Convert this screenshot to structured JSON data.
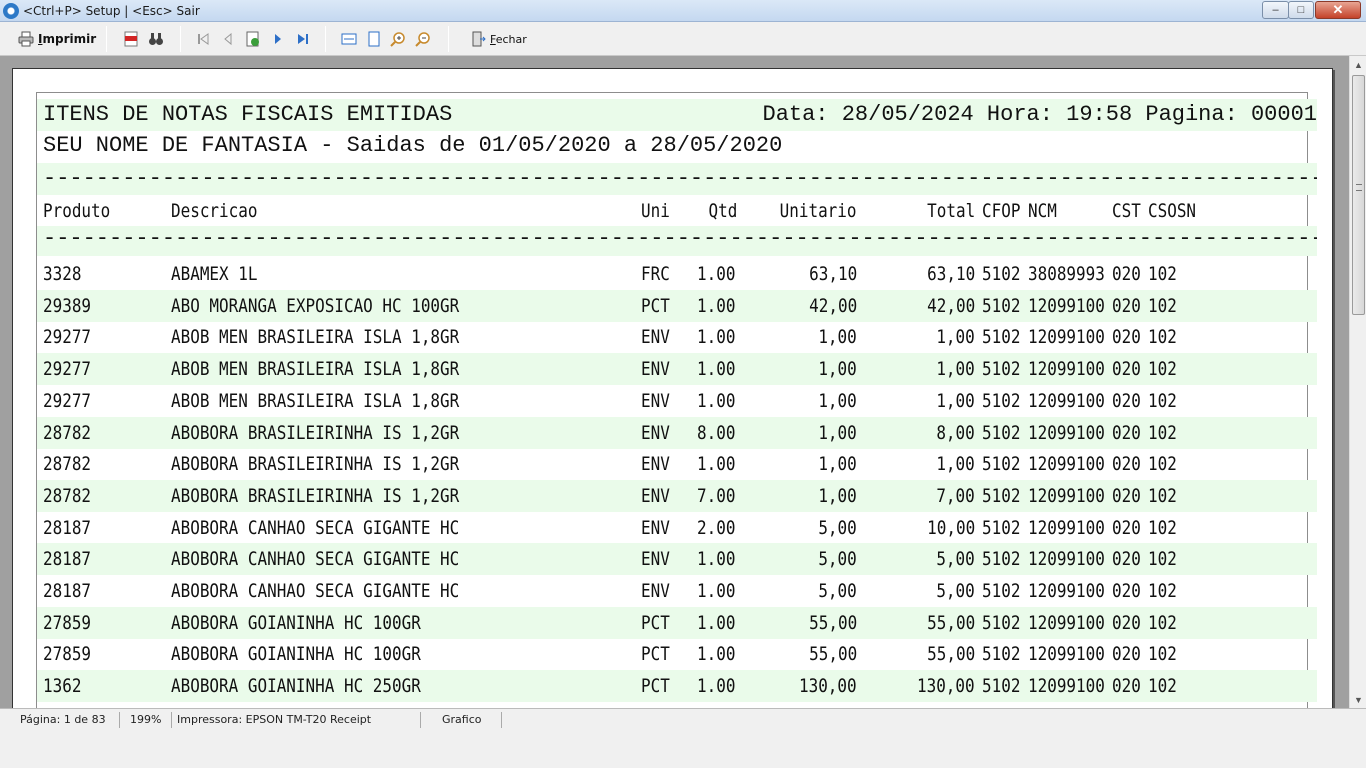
{
  "window": {
    "title": "<Ctrl+P> Setup | <Esc> Sair",
    "min_glyph": "–",
    "max_glyph": "□",
    "close_glyph": "✕"
  },
  "toolbar": {
    "print_label_underlined": "I",
    "print_label_rest": "mprimir",
    "close_label_underlined": "F",
    "close_label_rest": "echar",
    "pdf_icon": "pdf-icon",
    "search_icon": "binoculars-icon"
  },
  "report": {
    "title": "ITENS DE NOTAS FISCAIS EMITIDAS",
    "date_time_page": "Data: 28/05/2024 Hora: 19:58 Pagina: 00001",
    "subtitle": "SEU NOME DE FANTASIA - Saidas de 01/05/2020 a 28/05/2020",
    "separator": "------------------------------------------------------------------------------------------------------------------------------------------------------------------------",
    "columns": {
      "produto": "Produto",
      "descricao": "Descricao",
      "uni": "Uni",
      "qtd": "Qtd",
      "unitario": "Unitario",
      "total": "Total",
      "cfop": "CFOP",
      "ncm": "NCM",
      "cst": "CST",
      "csosn": "CSOSN"
    },
    "rows": [
      {
        "produto": "3328",
        "descricao": "ABAMEX 1L",
        "uni": "FRC",
        "qtd": "1.00",
        "unitario": "63,10",
        "total": "63,10",
        "cfop": "5102",
        "ncm": "38089993",
        "cst": "020",
        "csosn": "102"
      },
      {
        "produto": "29389",
        "descricao": "ABO MORANGA EXPOSICAO HC 100GR",
        "uni": "PCT",
        "qtd": "1.00",
        "unitario": "42,00",
        "total": "42,00",
        "cfop": "5102",
        "ncm": "12099100",
        "cst": "020",
        "csosn": "102"
      },
      {
        "produto": "29277",
        "descricao": "ABOB MEN BRASILEIRA ISLA 1,8GR",
        "uni": "ENV",
        "qtd": "1.00",
        "unitario": "1,00",
        "total": "1,00",
        "cfop": "5102",
        "ncm": "12099100",
        "cst": "020",
        "csosn": "102"
      },
      {
        "produto": "29277",
        "descricao": "ABOB MEN BRASILEIRA ISLA 1,8GR",
        "uni": "ENV",
        "qtd": "1.00",
        "unitario": "1,00",
        "total": "1,00",
        "cfop": "5102",
        "ncm": "12099100",
        "cst": "020",
        "csosn": "102"
      },
      {
        "produto": "29277",
        "descricao": "ABOB MEN BRASILEIRA ISLA 1,8GR",
        "uni": "ENV",
        "qtd": "1.00",
        "unitario": "1,00",
        "total": "1,00",
        "cfop": "5102",
        "ncm": "12099100",
        "cst": "020",
        "csosn": "102"
      },
      {
        "produto": "28782",
        "descricao": "ABOBORA BRASILEIRINHA IS 1,2GR",
        "uni": "ENV",
        "qtd": "8.00",
        "unitario": "1,00",
        "total": "8,00",
        "cfop": "5102",
        "ncm": "12099100",
        "cst": "020",
        "csosn": "102"
      },
      {
        "produto": "28782",
        "descricao": "ABOBORA BRASILEIRINHA IS 1,2GR",
        "uni": "ENV",
        "qtd": "1.00",
        "unitario": "1,00",
        "total": "1,00",
        "cfop": "5102",
        "ncm": "12099100",
        "cst": "020",
        "csosn": "102"
      },
      {
        "produto": "28782",
        "descricao": "ABOBORA BRASILEIRINHA IS 1,2GR",
        "uni": "ENV",
        "qtd": "7.00",
        "unitario": "1,00",
        "total": "7,00",
        "cfop": "5102",
        "ncm": "12099100",
        "cst": "020",
        "csosn": "102"
      },
      {
        "produto": "28187",
        "descricao": "ABOBORA CANHAO SECA GIGANTE HC",
        "uni": "ENV",
        "qtd": "2.00",
        "unitario": "5,00",
        "total": "10,00",
        "cfop": "5102",
        "ncm": "12099100",
        "cst": "020",
        "csosn": "102"
      },
      {
        "produto": "28187",
        "descricao": "ABOBORA CANHAO SECA GIGANTE HC",
        "uni": "ENV",
        "qtd": "1.00",
        "unitario": "5,00",
        "total": "5,00",
        "cfop": "5102",
        "ncm": "12099100",
        "cst": "020",
        "csosn": "102"
      },
      {
        "produto": "28187",
        "descricao": "ABOBORA CANHAO SECA GIGANTE HC",
        "uni": "ENV",
        "qtd": "1.00",
        "unitario": "5,00",
        "total": "5,00",
        "cfop": "5102",
        "ncm": "12099100",
        "cst": "020",
        "csosn": "102"
      },
      {
        "produto": "27859",
        "descricao": "ABOBORA GOIANINHA HC 100GR",
        "uni": "PCT",
        "qtd": "1.00",
        "unitario": "55,00",
        "total": "55,00",
        "cfop": "5102",
        "ncm": "12099100",
        "cst": "020",
        "csosn": "102"
      },
      {
        "produto": "27859",
        "descricao": "ABOBORA GOIANINHA HC 100GR",
        "uni": "PCT",
        "qtd": "1.00",
        "unitario": "55,00",
        "total": "55,00",
        "cfop": "5102",
        "ncm": "12099100",
        "cst": "020",
        "csosn": "102"
      },
      {
        "produto": "1362",
        "descricao": "ABOBORA GOIANINHA HC 250GR",
        "uni": "PCT",
        "qtd": "1.00",
        "unitario": "130,00",
        "total": "130,00",
        "cfop": "5102",
        "ncm": "12099100",
        "cst": "020",
        "csosn": "102"
      }
    ]
  },
  "status": {
    "page": "Página: 1 de 83",
    "zoom": "199%",
    "printer": "Impressora: EPSON TM-T20 Receipt",
    "mode": "Grafico"
  },
  "colors": {
    "stripe": "#eafbea",
    "accent": "#2d79c7"
  }
}
